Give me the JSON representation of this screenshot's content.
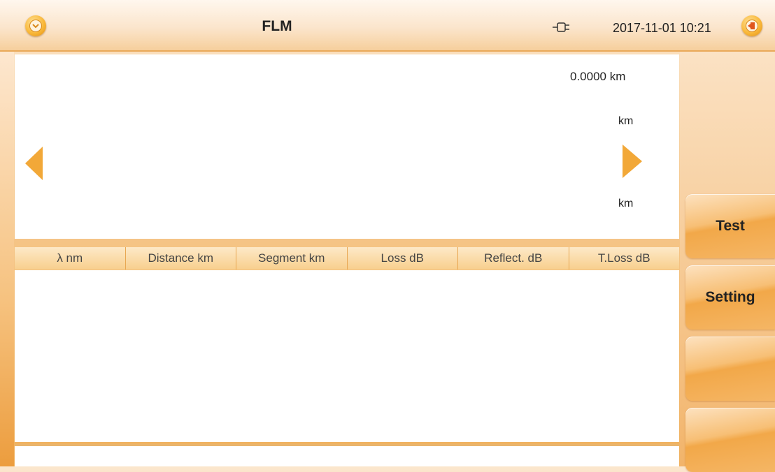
{
  "header": {
    "title": "FLM",
    "datetime": "2017-11-01 10:21",
    "menu_icon": "chevron-down-icon",
    "exit_icon": "exit-icon",
    "power_icon": "plug-icon"
  },
  "graph": {
    "distance_readout": "0.0000 km",
    "scale_top_unit": "km",
    "scale_bottom_unit": "km"
  },
  "table": {
    "columns": [
      "λ nm",
      "Distance km",
      "Segment km",
      "Loss dB",
      "Reflect. dB",
      "T.Loss dB"
    ],
    "rows": []
  },
  "side_buttons": {
    "test_label": "Test",
    "setting_label": "Setting",
    "button3_label": "",
    "button4_label": ""
  },
  "colors": {
    "accent": "#f2a838",
    "header_bg": "#fbe5cc",
    "table_header_bg": "#f8cf8d"
  }
}
